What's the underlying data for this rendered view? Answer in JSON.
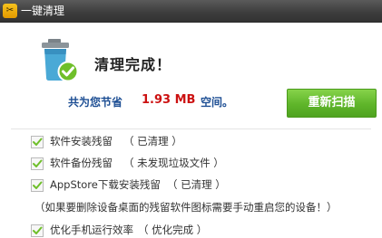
{
  "window": {
    "title": "一键清理",
    "app_icon": "broom-icon"
  },
  "result": {
    "title": "清理完成！",
    "saved_label": "共为您节省",
    "saved_amount": "1.93 MB",
    "saved_suffix": "空间。",
    "icon": "trash-bin-check-icon"
  },
  "rescan_button": {
    "label": "重新扫描"
  },
  "items": [
    {
      "label": "软件安装残留",
      "status": "（ 已清理 ）",
      "checked": true
    },
    {
      "label": "软件备份残留",
      "status": "（ 未发现垃圾文件 ）",
      "checked": true
    },
    {
      "label": "AppStore下载安装残留",
      "status": "（ 已清理 ）",
      "checked": true
    },
    {
      "label": "优化手机运行效率",
      "status": "（ 优化完成 ）",
      "checked": true
    }
  ],
  "note": "（如果要删除设备桌面的残留软件图标需要手动重启您的设备！）",
  "colors": {
    "accent_green": "#5fb52a",
    "amount_red": "#cc1111",
    "label_blue": "#1e4f94",
    "bin_blue": "#4aa9d6",
    "check_green": "#6fbf2a"
  }
}
